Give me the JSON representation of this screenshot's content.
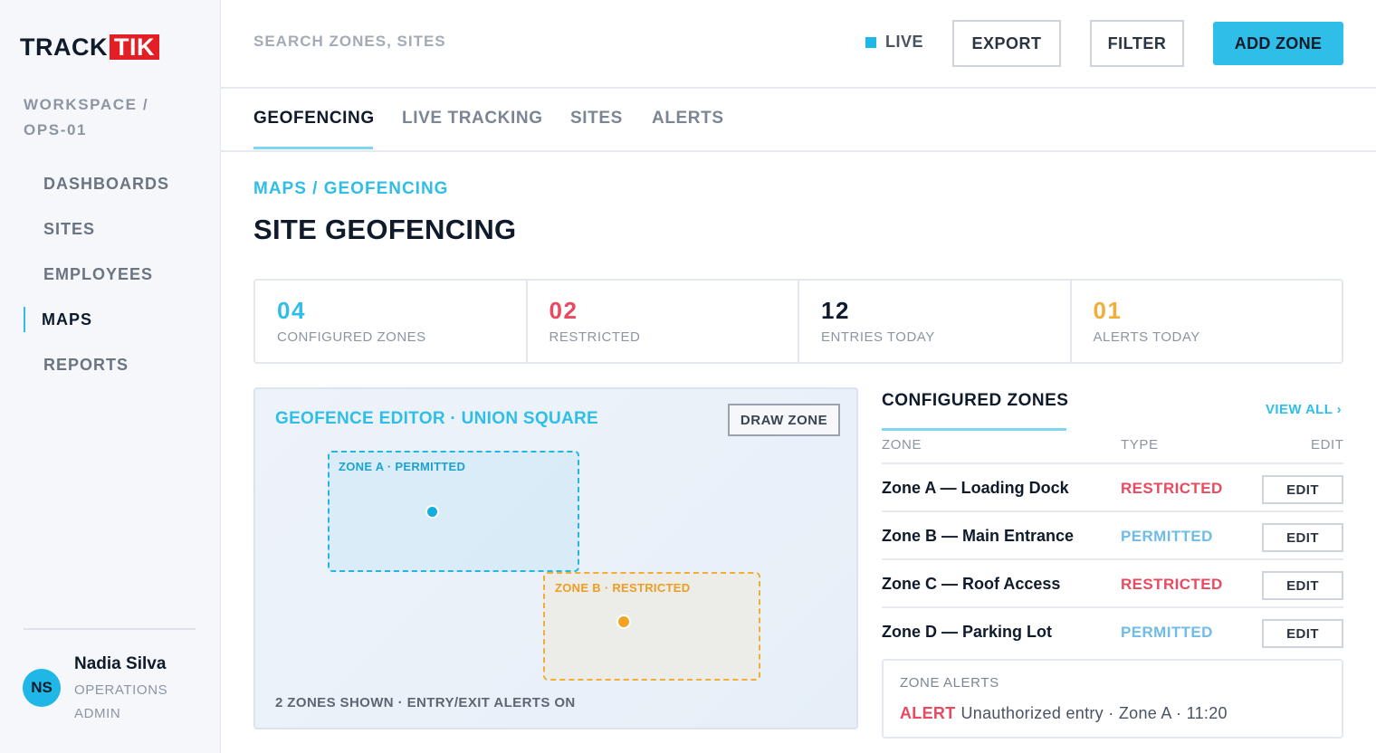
{
  "brand": {
    "track": "TRACK",
    "tik": "TIK",
    "accent": "#2ebee8",
    "logo_red": "#e31e24"
  },
  "sidebar": {
    "workspace": "WORKSPACE / OPS-01",
    "items": [
      {
        "label": "DASHBOARDS",
        "active": false
      },
      {
        "label": "SITES",
        "active": false
      },
      {
        "label": "EMPLOYEES",
        "active": false
      },
      {
        "label": "MAPS",
        "active": true
      },
      {
        "label": "REPORTS",
        "active": false
      }
    ],
    "user": {
      "initials": "NS",
      "name": "Nadia Silva",
      "role": "OPERATIONS ADMIN"
    }
  },
  "topbar": {
    "search_placeholder": "SEARCH ZONES, SITES",
    "live_label": "LIVE",
    "export_label": "EXPORT",
    "filter_label": "FILTER",
    "add_label": "ADD ZONE"
  },
  "tabs": [
    {
      "label": "GEOFENCING",
      "active": true
    },
    {
      "label": "LIVE TRACKING",
      "active": false
    },
    {
      "label": "SITES",
      "active": false
    },
    {
      "label": "ALERTS",
      "active": false
    }
  ],
  "header": {
    "breadcrumb": "MAPS / GEOFENCING",
    "title": "SITE GEOFENCING"
  },
  "stats": [
    {
      "value": "04",
      "label": "CONFIGURED ZONES",
      "color": "#2ebee8"
    },
    {
      "value": "02",
      "label": "RESTRICTED",
      "color": "#e84a5f"
    },
    {
      "value": "12",
      "label": "ENTRIES TODAY",
      "color": "#0f1a2b"
    },
    {
      "value": "01",
      "label": "ALERTS TODAY",
      "color": "#f0ad38"
    }
  ],
  "editor": {
    "title": "GEOFENCE EDITOR · UNION SQUARE",
    "draw_label": "DRAW ZONE",
    "zone_a_label": "ZONE A · PERMITTED",
    "zone_b_label": "ZONE B · RESTRICTED",
    "footer": "2 ZONES SHOWN · ENTRY/EXIT ALERTS ON"
  },
  "zones_panel": {
    "title": "CONFIGURED ZONES",
    "view_all": "VIEW ALL ›",
    "headers": {
      "zone": "ZONE",
      "type": "TYPE",
      "edit": "EDIT"
    },
    "rows": [
      {
        "name": "Zone A — Loading Dock",
        "type": "RESTRICTED",
        "edit": "EDIT"
      },
      {
        "name": "Zone B — Main Entrance",
        "type": "PERMITTED",
        "edit": "EDIT"
      },
      {
        "name": "Zone C — Roof Access",
        "type": "RESTRICTED",
        "edit": "EDIT"
      },
      {
        "name": "Zone D — Parking Lot",
        "type": "PERMITTED",
        "edit": "EDIT"
      }
    ]
  },
  "alerts": {
    "title": "ZONE ALERTS",
    "tag": "ALERT",
    "message": "Unauthorized entry · Zone A · 11:20"
  }
}
